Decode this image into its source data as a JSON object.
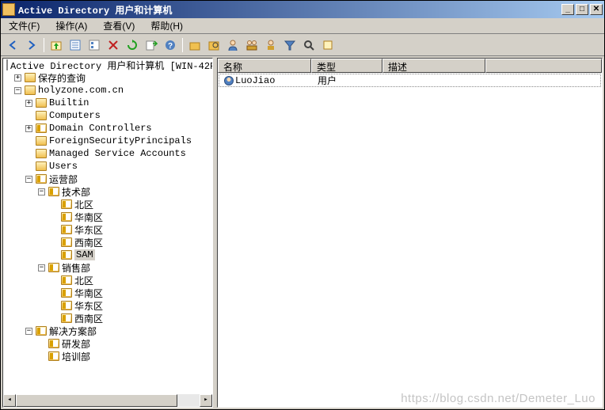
{
  "title": "Active Directory 用户和计算机",
  "window_controls": {
    "min": "_",
    "max": "□",
    "close": "✕"
  },
  "menus": {
    "file": "文件(F)",
    "action": "操作(A)",
    "view": "查看(V)",
    "help": "帮助(H)"
  },
  "toolbar_icons": [
    "back",
    "forward",
    "up",
    "props",
    "delete",
    "refresh",
    "export",
    "help",
    "sep",
    "new-ou",
    "new-user",
    "new-group",
    "new-contact",
    "sep",
    "filter",
    "find",
    "saved"
  ],
  "tree": {
    "root": "Active Directory 用户和计算机 [WIN-42F",
    "saved_queries": "保存的查询",
    "domain": "holyzone.com.cn",
    "containers": {
      "builtin": "Builtin",
      "computers": "Computers",
      "dc": "Domain Controllers",
      "fsp": "ForeignSecurityPrincipals",
      "msa": "Managed Service Accounts",
      "users": "Users"
    },
    "ou_ops": "运营部",
    "ou_tech": "技术部",
    "tech_children": {
      "north": "北区",
      "south": "华南区",
      "east": "华东区",
      "sw": "西南区",
      "sam": "SAM"
    },
    "ou_sales": "销售部",
    "sales_children": {
      "north": "北区",
      "south": "华南区",
      "east": "华东区",
      "sw": "西南区"
    },
    "ou_solutions": "解决方案部",
    "sol_children": {
      "rd": "研发部",
      "training": "培训部"
    }
  },
  "list": {
    "headers": {
      "name": "名称",
      "type": "类型",
      "desc": "描述"
    },
    "col_widths": {
      "name": 118,
      "type": 90,
      "desc": 130
    },
    "rows": [
      {
        "name": "LuoJiao",
        "type": "用户",
        "desc": ""
      }
    ]
  },
  "watermark": "https://blog.csdn.net/Demeter_Luo"
}
